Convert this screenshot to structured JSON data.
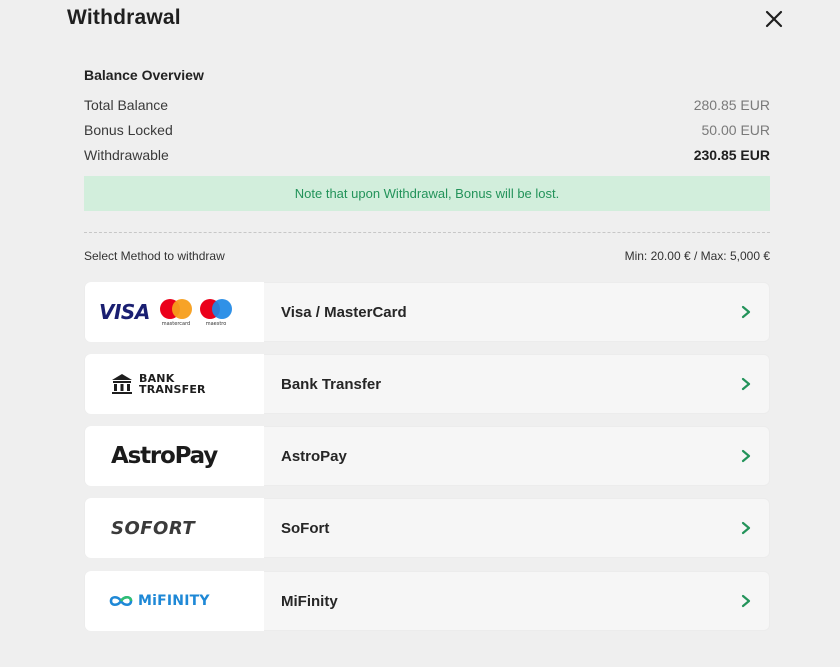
{
  "header": {
    "title": "Withdrawal",
    "close_icon": "close-icon"
  },
  "balance": {
    "section_title": "Balance Overview",
    "rows": [
      {
        "label": "Total Balance",
        "value": "280.85 EUR"
      },
      {
        "label": "Bonus Locked",
        "value": "50.00 EUR"
      },
      {
        "label": "Withdrawable",
        "value": "230.85 EUR"
      }
    ]
  },
  "note": {
    "text": "Note that upon Withdrawal, Bonus will be lost.",
    "bg_color": "#d2eedc",
    "text_color": "#23935a"
  },
  "methods_header": {
    "label": "Select Method to withdraw",
    "limits": "Min: 20.00 € / Max: 5,000 €"
  },
  "methods": [
    {
      "label": "Visa / MasterCard",
      "logo": {
        "visa": "VISA",
        "mastercard_caption": "mastercard",
        "maestro_caption": "maestro"
      }
    },
    {
      "label": "Bank Transfer",
      "logo": {
        "line1": "BANK",
        "line2": "TRANSFER"
      }
    },
    {
      "label": "AstroPay",
      "logo": {
        "text": "AstroPay"
      }
    },
    {
      "label": "SoFort",
      "logo": {
        "text": "SOFORT"
      }
    },
    {
      "label": "MiFinity",
      "logo": {
        "text": "MiFINITY"
      }
    }
  ],
  "accent_color": "#23935a"
}
